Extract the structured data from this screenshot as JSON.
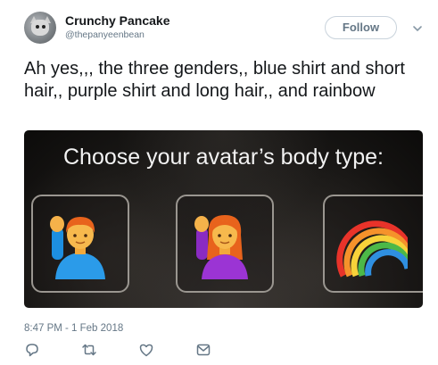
{
  "user": {
    "display_name": "Crunchy Pancake",
    "handle": "@thepanyeenbean"
  },
  "follow_button": {
    "label": "Follow"
  },
  "tweet": {
    "text": "Ah yes,,, the three genders,, blue shirt and short hair,, purple shirt and long hair,, and rainbow",
    "timestamp": "8:47 PM - 1 Feb 2018"
  },
  "media": {
    "title": "Choose your avatar’s body type:",
    "options": [
      {
        "icon": "man-raising-hand-icon"
      },
      {
        "icon": "woman-raising-hand-icon"
      },
      {
        "icon": "rainbow-icon"
      }
    ]
  },
  "actions": {
    "icons": [
      "reply-icon",
      "retweet-icon",
      "like-icon",
      "direct-message-icon"
    ],
    "icon_color": "#657786"
  },
  "colors": {
    "text": "#14171a",
    "secondary": "#657786",
    "border": "#c9d3dc"
  }
}
